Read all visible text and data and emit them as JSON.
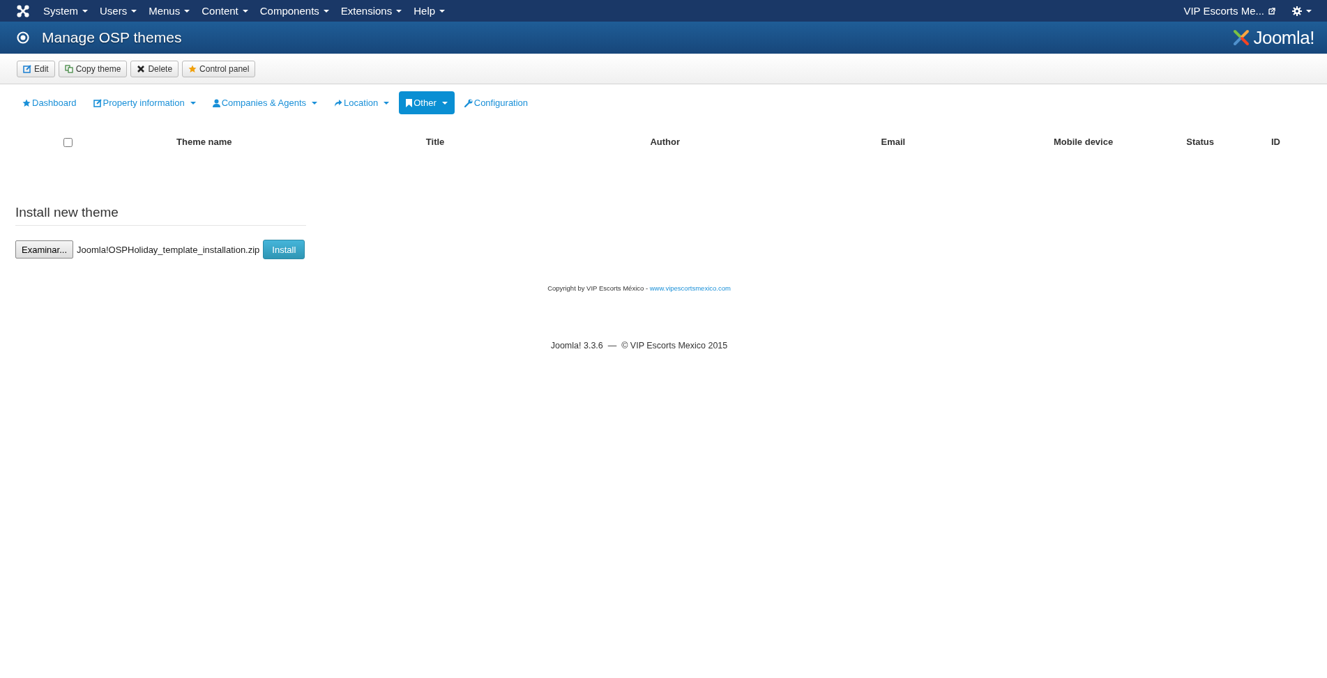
{
  "top_menu": {
    "items": [
      {
        "label": "System"
      },
      {
        "label": "Users"
      },
      {
        "label": "Menus"
      },
      {
        "label": "Content"
      },
      {
        "label": "Components"
      },
      {
        "label": "Extensions"
      },
      {
        "label": "Help"
      }
    ],
    "site_link": "VIP Escorts Me..."
  },
  "header": {
    "title": "Manage OSP themes",
    "logo_text": "Joomla!"
  },
  "toolbar": [
    {
      "label": "Edit",
      "kind": "edit"
    },
    {
      "label": "Copy theme",
      "kind": "copy"
    },
    {
      "label": "Delete",
      "kind": "delete"
    },
    {
      "label": "Control panel",
      "kind": "star"
    }
  ],
  "nav_tabs": [
    {
      "label": "Dashboard",
      "kind": "star",
      "dropdown": false,
      "selected": false
    },
    {
      "label": "Property information",
      "kind": "edit",
      "dropdown": true,
      "selected": false
    },
    {
      "label": "Companies & Agents",
      "kind": "user",
      "dropdown": true,
      "selected": false
    },
    {
      "label": "Location",
      "kind": "share",
      "dropdown": true,
      "selected": false
    },
    {
      "label": "Other",
      "kind": "bookmark",
      "dropdown": true,
      "selected": true
    },
    {
      "label": "Configuration",
      "kind": "wrench",
      "dropdown": false,
      "selected": false
    }
  ],
  "table": {
    "select_all_checked": false,
    "columns": [
      "Theme name",
      "Title",
      "Author",
      "Email",
      "Mobile device",
      "Status",
      "ID"
    ]
  },
  "install": {
    "heading": "Install new theme",
    "browse_button": "Examinar...",
    "file_name": "Joomla!OSPHoliday_template_installation.zip",
    "install_button": "Install"
  },
  "copyright": {
    "text": "Copyright by VIP Escorts México - ",
    "link": "www.vipescortsmexico.com"
  },
  "footer": "Joomla! 3.3.6  —  © VIP Escorts Mexico 2015"
}
